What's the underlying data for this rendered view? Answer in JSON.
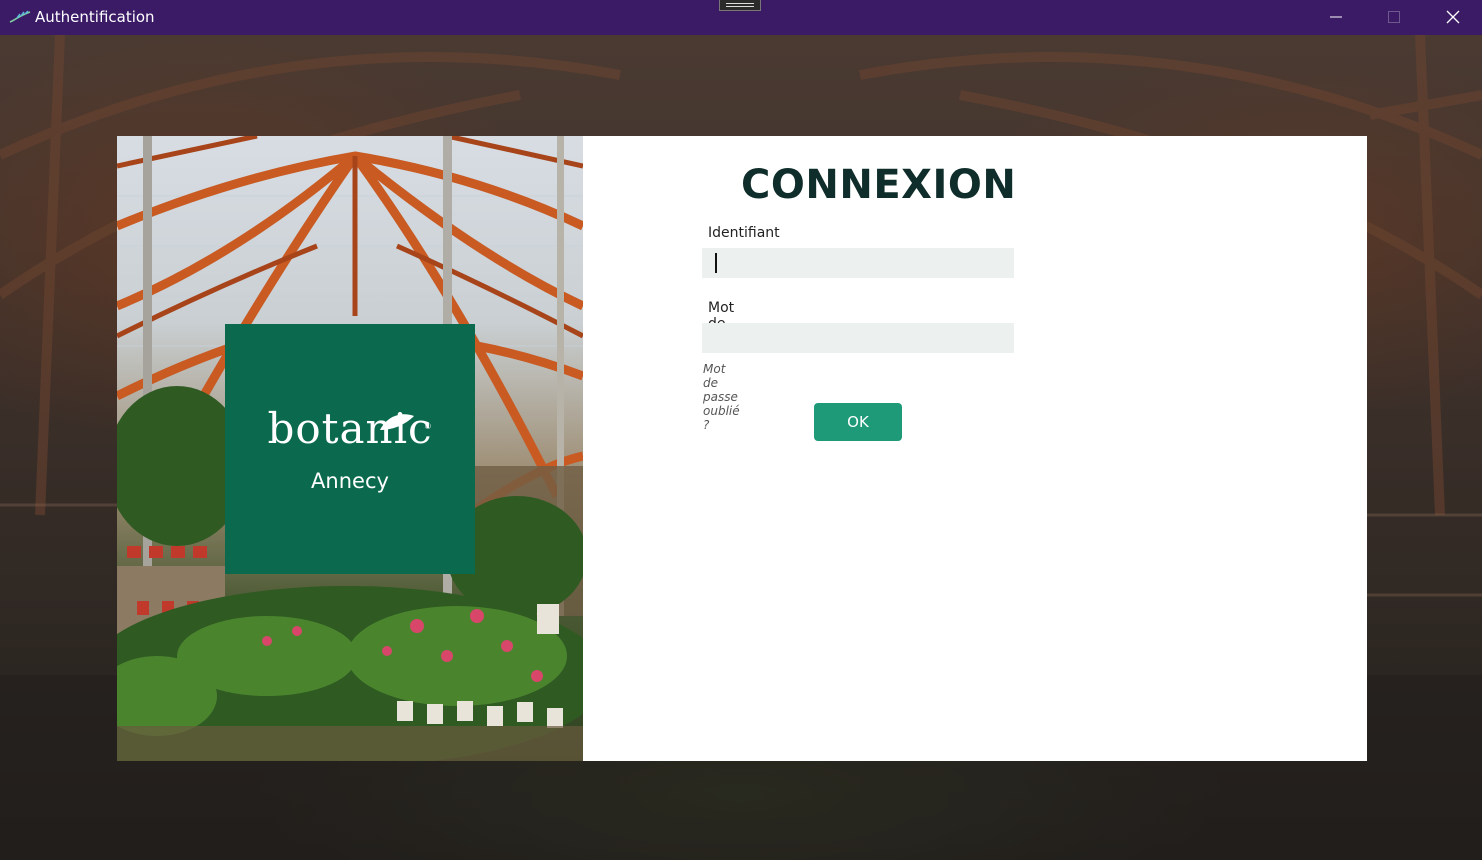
{
  "window": {
    "title": "Authentification",
    "app_icon": "leaf-logo-icon",
    "controls": [
      "minimize-icon",
      "maximize-icon",
      "close-icon"
    ]
  },
  "brand": {
    "name": "botanic",
    "registered_mark": "®",
    "location": "Annecy",
    "color": "#0b6a4d"
  },
  "login": {
    "title": "CONNEXION",
    "username_label": "Identifiant",
    "username_value": "",
    "password_label": "Mot de passe",
    "password_value": "",
    "forgot_link": "Mot de passe oublié ?",
    "ok_label": "OK",
    "ok_color": "#1e9a78"
  },
  "colors": {
    "titlebar": "#3b1a66",
    "field_background": "#ecf1ef",
    "title_text": "#0f2d2a"
  }
}
